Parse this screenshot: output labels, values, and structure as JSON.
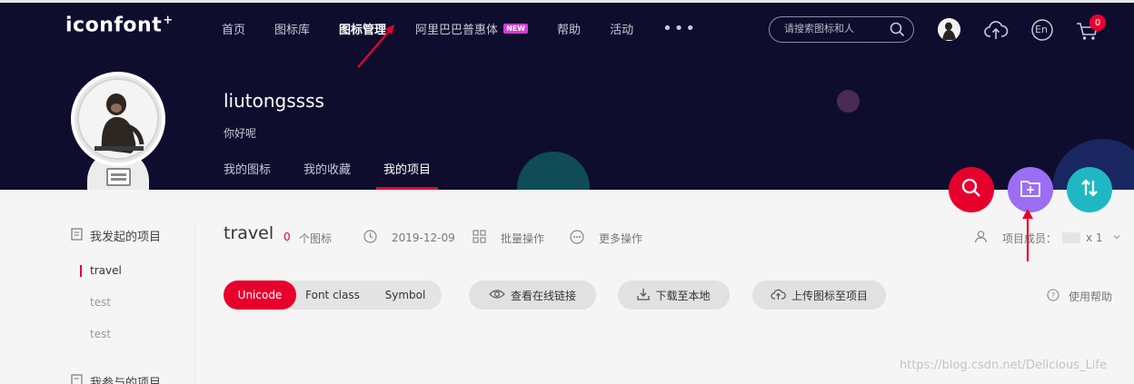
{
  "logo": {
    "text": "iconfont",
    "mark": "+"
  },
  "nav": {
    "items": [
      {
        "label": "首页",
        "active": false
      },
      {
        "label": "图标库",
        "active": false
      },
      {
        "label": "图标管理",
        "active": true
      },
      {
        "label": "阿里巴巴普惠体",
        "active": false,
        "badge": "NEW"
      },
      {
        "label": "帮助",
        "active": false
      },
      {
        "label": "活动",
        "active": false
      }
    ],
    "more": "•••"
  },
  "search": {
    "placeholder": "请搜索图标和人"
  },
  "header_icons": {
    "lang": "En",
    "cart_count": "0"
  },
  "profile": {
    "username": "liutongssss",
    "bio": "你好呢",
    "tabs": [
      "我的图标",
      "我的收藏",
      "我的项目"
    ],
    "active_tab": "我的项目"
  },
  "sidebar": {
    "created_heading": "我发起的项目",
    "projects": [
      "travel",
      "test",
      "test"
    ],
    "active_project": "travel",
    "joined_heading": "我参与的项目"
  },
  "project": {
    "name": "travel",
    "icon_count": "0",
    "icon_count_label": "个图标",
    "date": "2019-12-09",
    "batch_label": "批量操作",
    "more_label": "更多操作",
    "members_label": "项目成员：",
    "members_count": "x 1"
  },
  "toolbar": {
    "segments": [
      "Unicode",
      "Font class",
      "Symbol"
    ],
    "active_segment": "Unicode",
    "view_link": "查看在线链接",
    "download": "下载至本地",
    "upload": "上传图标至项目",
    "help": "使用帮助"
  },
  "watermark": "https://blog.csdn.net/Delicious_Life",
  "colors": {
    "header_bg": "#0f0d2e",
    "accent_red": "#e8002d",
    "purple": "#9b6ef3",
    "teal": "#1fb8c2"
  }
}
